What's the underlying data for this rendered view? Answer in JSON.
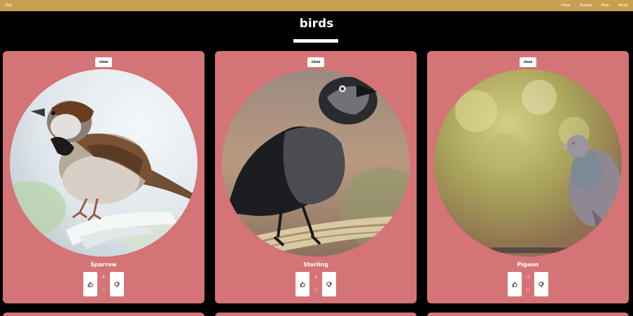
{
  "nav": {
    "brand": "Zoo",
    "links": [
      "Home",
      "Animals",
      "Birds",
      "About"
    ]
  },
  "page": {
    "title": "birds"
  },
  "cards": [
    {
      "name": "Sparrow",
      "close_label": "close",
      "likes": "8"
    },
    {
      "name": "Starling",
      "close_label": "close",
      "likes": "5"
    },
    {
      "name": "Pigeon",
      "close_label": "close",
      "likes": "-1"
    }
  ],
  "icons": {
    "like": "thumbs-up-icon",
    "dislike": "thumbs-down-icon",
    "favorite": "heart-icon"
  },
  "colors": {
    "nav_bg": "#c8a052",
    "card_bg": "#d47476",
    "page_bg": "#000000"
  }
}
